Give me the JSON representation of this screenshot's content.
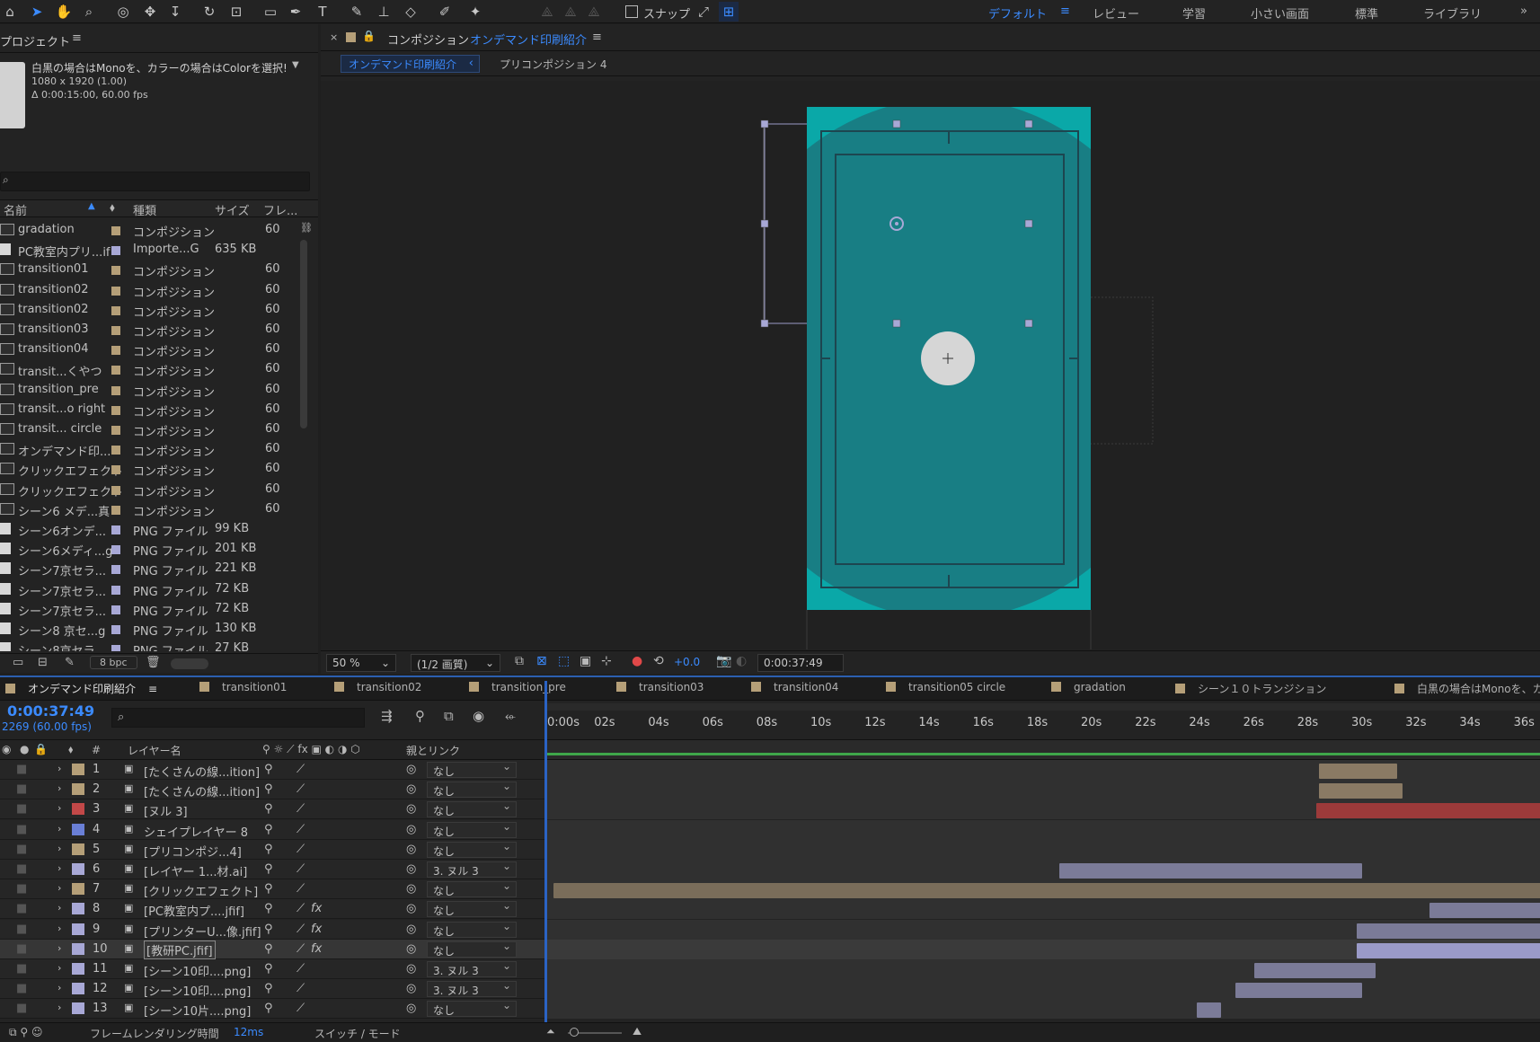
{
  "toolbar": {
    "snap_label": "スナップ",
    "workspaces": [
      "デフォルト",
      "レビュー",
      "学習",
      "小さい画面",
      "標準",
      "ライブラリ"
    ],
    "active_workspace": "デフォルト",
    "more": "»"
  },
  "project": {
    "title": "プロジェクト",
    "menu": "≡",
    "selected_name": "白黒の場合はMonoを、カラーの場合はColorを選択!",
    "dims": "1080 x 1920 (1.00)",
    "duration": "Δ 0:00:15:00, 60.00 fps",
    "search_placeholder": "",
    "columns": {
      "name": "名前",
      "type": "種類",
      "size": "サイズ",
      "frames": "フレ..."
    },
    "items": [
      {
        "name": "gradation",
        "type": "コンポジション",
        "size": "",
        "frames": "60",
        "kind": "comp",
        "color": "#b59f78"
      },
      {
        "name": "PC教室内プリ...if",
        "type": "Importe...G",
        "size": "635 KB",
        "frames": "",
        "kind": "file",
        "color": "#a8a8d6"
      },
      {
        "name": "transition01",
        "type": "コンポジション",
        "size": "",
        "frames": "60",
        "kind": "comp",
        "color": "#b59f78"
      },
      {
        "name": "transition02",
        "type": "コンポジション",
        "size": "",
        "frames": "60",
        "kind": "comp",
        "color": "#b59f78"
      },
      {
        "name": "transition02",
        "type": "コンポジション",
        "size": "",
        "frames": "60",
        "kind": "comp",
        "color": "#b59f78"
      },
      {
        "name": "transition03",
        "type": "コンポジション",
        "size": "",
        "frames": "60",
        "kind": "comp",
        "color": "#b59f78"
      },
      {
        "name": "transition04",
        "type": "コンポジション",
        "size": "",
        "frames": "60",
        "kind": "comp",
        "color": "#b59f78"
      },
      {
        "name": "transit...くやつ",
        "type": "コンポジション",
        "size": "",
        "frames": "60",
        "kind": "comp",
        "color": "#b59f78"
      },
      {
        "name": "transition_pre",
        "type": "コンポジション",
        "size": "",
        "frames": "60",
        "kind": "comp",
        "color": "#b59f78"
      },
      {
        "name": "transit...o right",
        "type": "コンポジション",
        "size": "",
        "frames": "60",
        "kind": "comp",
        "color": "#b59f78"
      },
      {
        "name": "transit... circle",
        "type": "コンポジション",
        "size": "",
        "frames": "60",
        "kind": "comp",
        "color": "#b59f78"
      },
      {
        "name": "オンデマンド印...",
        "type": "コンポジション",
        "size": "",
        "frames": "60",
        "kind": "comp",
        "color": "#b59f78"
      },
      {
        "name": "クリックエフェクト",
        "type": "コンポジション",
        "size": "",
        "frames": "60",
        "kind": "comp",
        "color": "#b59f78"
      },
      {
        "name": "クリックエフェクト",
        "type": "コンポジション",
        "size": "",
        "frames": "60",
        "kind": "comp",
        "color": "#b59f78"
      },
      {
        "name": "シーン6 メデ...真",
        "type": "コンポジション",
        "size": "",
        "frames": "60",
        "kind": "comp",
        "color": "#b59f78"
      },
      {
        "name": "シーン6オンデ...",
        "type": "PNG ファイル",
        "size": "99 KB",
        "frames": "",
        "kind": "file",
        "color": "#a8a8d6"
      },
      {
        "name": "シーン6メディ...g",
        "type": "PNG ファイル",
        "size": "201 KB",
        "frames": "",
        "kind": "file",
        "color": "#a8a8d6"
      },
      {
        "name": "シーン7京セラ...",
        "type": "PNG ファイル",
        "size": "221 KB",
        "frames": "",
        "kind": "file",
        "color": "#a8a8d6"
      },
      {
        "name": "シーン7京セラ...",
        "type": "PNG ファイル",
        "size": "72 KB",
        "frames": "",
        "kind": "file",
        "color": "#a8a8d6"
      },
      {
        "name": "シーン7京セラ...",
        "type": "PNG ファイル",
        "size": "72 KB",
        "frames": "",
        "kind": "file",
        "color": "#a8a8d6"
      },
      {
        "name": "シーン8 京セ...g",
        "type": "PNG ファイル",
        "size": "130 KB",
        "frames": "",
        "kind": "file",
        "color": "#a8a8d6"
      },
      {
        "name": "シーン8京セラ...",
        "type": "PNG ファイル",
        "size": "27 KB",
        "frames": "",
        "kind": "file",
        "color": "#a8a8d6"
      }
    ],
    "bpc": "8 bpc"
  },
  "composition": {
    "close": "×",
    "label": "コンポジション",
    "name": "オンデマンド印刷紹介",
    "menu": "≡",
    "breadcrumb": [
      "オンデマンド印刷紹介",
      "プリコンポジション 4"
    ],
    "zoom": "50 %",
    "quality": "(1/2 画質)",
    "exposure": "+0.0",
    "timecode": "0:00:37:49"
  },
  "timeline": {
    "tabs": [
      {
        "label": "オンデマンド印刷紹介",
        "color": "#b59f78",
        "active": true
      },
      {
        "label": "transition01",
        "color": "#b59f78"
      },
      {
        "label": "transition02",
        "color": "#b59f78"
      },
      {
        "label": "transition_pre",
        "color": "#b59f78"
      },
      {
        "label": "transition03",
        "color": "#b59f78"
      },
      {
        "label": "transition04",
        "color": "#b59f78"
      },
      {
        "label": "transition05 circle",
        "color": "#b59f78"
      },
      {
        "label": "gradation",
        "color": "#b59f78"
      },
      {
        "label": "シーン１０トランジション",
        "color": "#b59f78"
      },
      {
        "label": "白黒の場合はMonoを、カ",
        "color": "#b59f78"
      }
    ],
    "current_time": "0:00:37:49",
    "frame_info": "2269 (60.00 fps)",
    "columns": {
      "num": "#",
      "layer_name": "レイヤー名",
      "parent": "親とリンク"
    },
    "ruler": [
      "0:00s",
      "02s",
      "04s",
      "06s",
      "08s",
      "10s",
      "12s",
      "14s",
      "16s",
      "18s",
      "20s",
      "22s",
      "24s",
      "26s",
      "28s",
      "30s",
      "32s",
      "34s",
      "36s"
    ],
    "layers": [
      {
        "num": "1",
        "name": "[たくさんの線...ition]",
        "parent": "なし",
        "color": "#b59f78",
        "fx": false,
        "bar_start": 28.4,
        "bar_end": 31.3,
        "bar_color": "#8a7a64"
      },
      {
        "num": "2",
        "name": "[たくさんの線...ition]",
        "parent": "なし",
        "color": "#b59f78",
        "fx": false,
        "bar_start": 28.4,
        "bar_end": 31.5,
        "bar_color": "#8a7a64"
      },
      {
        "num": "3",
        "name": "[ヌル 3]",
        "parent": "なし",
        "color": "#c24848",
        "fx": false,
        "bar_start": 28.3,
        "bar_end": 37.0,
        "bar_color": "#9c3a3a"
      },
      {
        "num": "4",
        "name": "シェイプレイヤー 8",
        "parent": "なし",
        "color": "#6a7fd6",
        "fx": false,
        "bar_start": null,
        "bar_end": null,
        "bar_color": ""
      },
      {
        "num": "5",
        "name": "[プリコンポジ...4]",
        "parent": "なし",
        "color": "#b59f78",
        "fx": false,
        "bar_start": null,
        "bar_end": null,
        "bar_color": ""
      },
      {
        "num": "6",
        "name": "[レイヤー 1...材.ai]",
        "parent": "3. ヌル 3",
        "color": "#a8a8d6",
        "fx": false,
        "bar_start": 18.8,
        "bar_end": 30.0,
        "bar_color": "#7b7b98"
      },
      {
        "num": "7",
        "name": "[クリックエフェクト]",
        "parent": "なし",
        "color": "#b59f78",
        "fx": false,
        "bar_start": 0.1,
        "bar_end": 37.0,
        "bar_color": "#7a6d5a"
      },
      {
        "num": "8",
        "name": "[PC教室内プ....jfif]",
        "parent": "なし",
        "color": "#a8a8d6",
        "fx": true,
        "bar_start": 32.5,
        "bar_end": 37.0,
        "bar_color": "#7b7b98"
      },
      {
        "num": "9",
        "name": "[プリンターU...像.jfif]",
        "parent": "なし",
        "color": "#a8a8d6",
        "fx": true,
        "bar_start": 29.8,
        "bar_end": 37.0,
        "bar_color": "#7b7b98"
      },
      {
        "num": "10",
        "name": "[教研PC.jfif]",
        "parent": "なし",
        "color": "#a8a8d6",
        "fx": true,
        "bar_start": 29.8,
        "bar_end": 37.0,
        "bar_color": "#9a9ac8",
        "selected": true
      },
      {
        "num": "11",
        "name": "[シーン10印....png]",
        "parent": "3. ヌル 3",
        "color": "#a8a8d6",
        "fx": false,
        "bar_start": 26.0,
        "bar_end": 30.5,
        "bar_color": "#7b7b98"
      },
      {
        "num": "12",
        "name": "[シーン10印....png]",
        "parent": "3. ヌル 3",
        "color": "#a8a8d6",
        "fx": false,
        "bar_start": 25.3,
        "bar_end": 30.0,
        "bar_color": "#7b7b98"
      },
      {
        "num": "13",
        "name": "[シーン10片....png]",
        "parent": "なし",
        "color": "#a8a8d6",
        "fx": false,
        "bar_start": 23.9,
        "bar_end": 24.8,
        "bar_color": "#7b7b98"
      }
    ],
    "footer": {
      "render_label": "フレームレンダリング時間",
      "render_value": "12ms",
      "switch_mode": "スイッチ / モード"
    }
  }
}
